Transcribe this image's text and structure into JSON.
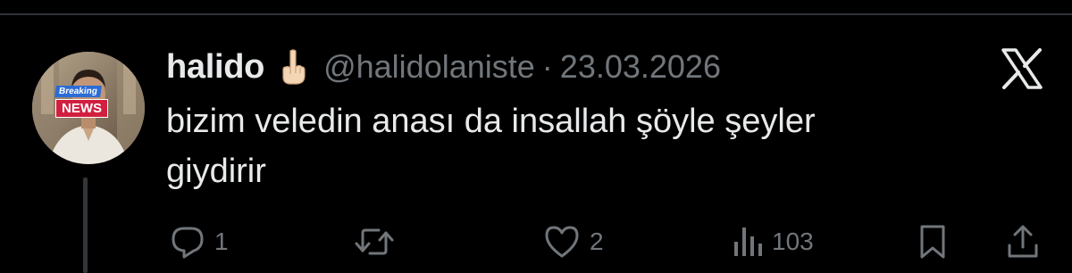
{
  "post": {
    "display_name": "halido",
    "name_emoji": "pointing-up-emoji",
    "handle": "@halidolaniste",
    "separator": "·",
    "date": "23.03.2026",
    "text": "bizim veledin anası da insallah şöyle şeyler\ngiydirir",
    "avatar_badge": {
      "top": "Breaking",
      "bottom": "NEWS"
    }
  },
  "actions": {
    "reply_count": "1",
    "repost_count": "",
    "like_count": "2",
    "views_count": "103"
  },
  "icons": {
    "brand": "x-logo-icon",
    "reply": "reply-icon",
    "repost": "repost-icon",
    "like": "heart-icon",
    "views": "views-icon",
    "bookmark": "bookmark-icon",
    "share": "share-icon"
  },
  "colors": {
    "background": "#000000",
    "primary_text": "#e7e9ea",
    "secondary_text": "#71767b",
    "divider": "#2f3336"
  }
}
